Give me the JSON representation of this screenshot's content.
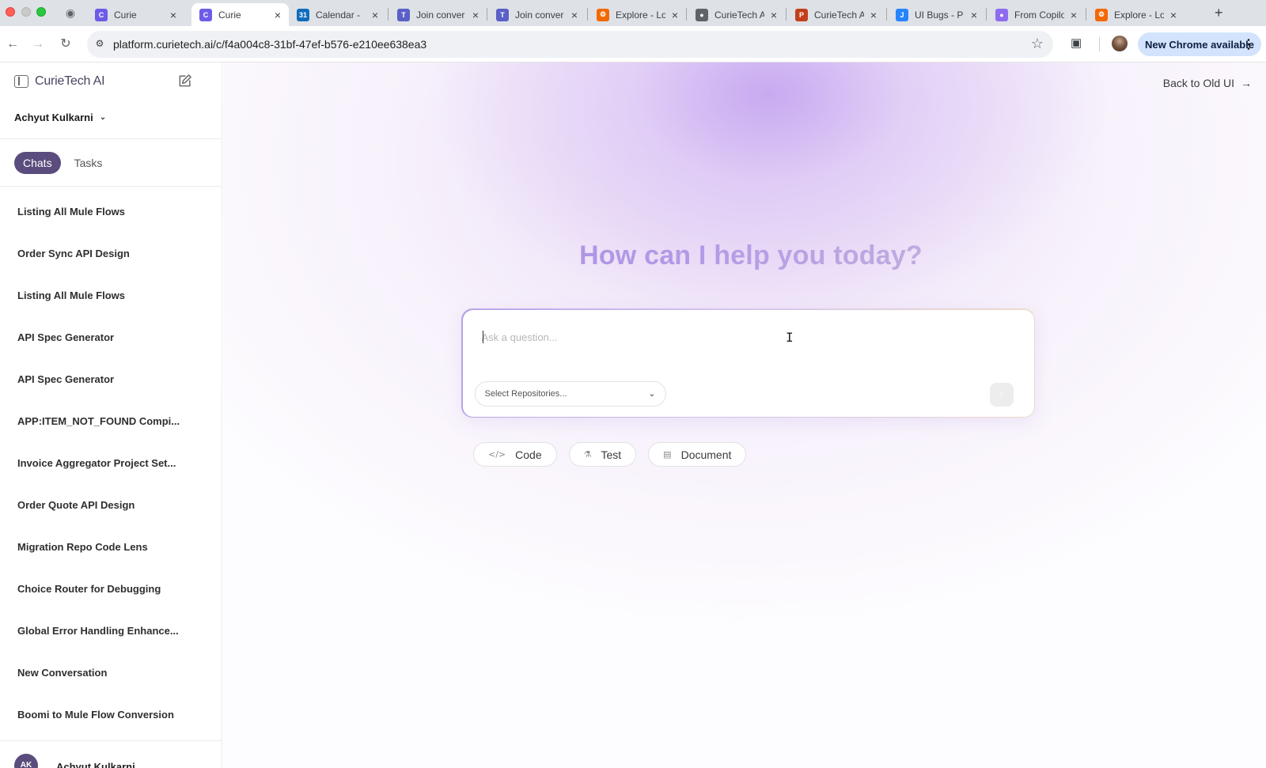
{
  "browser": {
    "tab_group_icon": "tab-search-icon",
    "tabs": [
      {
        "title": "Curie",
        "favicon": "curie",
        "color": "#6c5ce7",
        "active": false
      },
      {
        "title": "Curie",
        "favicon": "curie",
        "color": "#6c5ce7",
        "active": true
      },
      {
        "title": "Calendar - ",
        "favicon": "outlook-calendar",
        "color": "#0f6cbd",
        "active": false
      },
      {
        "title": "Join conver",
        "favicon": "teams",
        "color": "#5b5fc7",
        "active": false
      },
      {
        "title": "Join conver",
        "favicon": "teams",
        "color": "#5b5fc7",
        "active": false
      },
      {
        "title": "Explore - Lo",
        "favicon": "grafana",
        "color": "#f46800",
        "active": false
      },
      {
        "title": "CurieTech A",
        "favicon": "globe",
        "color": "#5f6368",
        "active": false
      },
      {
        "title": "CurieTech A",
        "favicon": "powerpoint",
        "color": "#c43e1c",
        "active": false
      },
      {
        "title": "UI Bugs - P",
        "favicon": "jira",
        "color": "#2684ff",
        "active": false
      },
      {
        "title": "From Copilo",
        "favicon": "copilot",
        "color": "#8e6cf0",
        "active": false
      },
      {
        "title": "Explore - Lo",
        "favicon": "grafana",
        "color": "#f46800",
        "active": false
      }
    ],
    "url": "platform.curietech.ai/c/f4a004c8-31bf-47ef-b576-e210ee638ea3",
    "update_label": "New Chrome available"
  },
  "sidebar": {
    "brand": "CurieTech AI",
    "user_name": "Achyut Kulkarni",
    "segments": [
      {
        "label": "Chats",
        "active": true
      },
      {
        "label": "Tasks",
        "active": false
      }
    ],
    "chats": [
      "Listing All Mule Flows",
      "Order Sync API Design",
      "Listing All Mule Flows",
      "API Spec Generator",
      "API Spec Generator",
      "APP:ITEM_NOT_FOUND Compi...",
      "Invoice Aggregator Project Set...",
      "Order Quote API Design",
      "Migration Repo Code Lens",
      "Choice Router for Debugging",
      "Global Error Handling Enhance...",
      "New Conversation",
      "Boomi to Mule Flow Conversion"
    ],
    "footer": {
      "initials": "AK",
      "name": "Achyut Kulkarni"
    }
  },
  "main": {
    "back_link": "Back to Old UI",
    "headline": "How can I help you today?",
    "composer": {
      "placeholder": "Ask a question...",
      "repo_placeholder": "Select Repositories..."
    },
    "modes": [
      {
        "label": "Code",
        "icon": "code-icon"
      },
      {
        "label": "Test",
        "icon": "flask-icon"
      },
      {
        "label": "Document",
        "icon": "document-icon"
      }
    ]
  },
  "colors": {
    "accent": "#5a4c7d",
    "update_pill": "#d3e3fd"
  }
}
